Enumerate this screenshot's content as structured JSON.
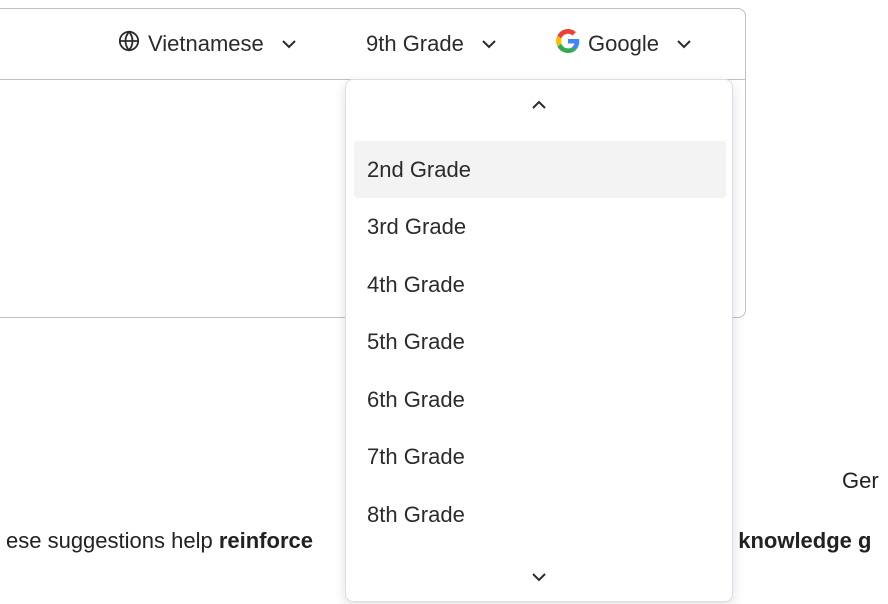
{
  "toolbar": {
    "language": {
      "label": "Vietnamese",
      "icon": "globe-icon"
    },
    "grade": {
      "label": "9th Grade"
    },
    "engine": {
      "label": "Google",
      "icon": "google-logo-icon"
    }
  },
  "dropdown": {
    "highlighted_index": 0,
    "options": [
      "2nd Grade",
      "3rd Grade",
      "4th Grade",
      "5th Grade",
      "6th Grade",
      "7th Grade",
      "8th Grade"
    ]
  },
  "background": {
    "text_right_top": "Ger",
    "text_left": "ese suggestions help ",
    "text_left_bold": "reinforce",
    "text_right_bold": "/ knowledge g"
  },
  "colors": {
    "border": "#b9c1cc",
    "highlight": "#f3f3f3",
    "text": "#2b2b2b",
    "google_blue": "#4285F4",
    "google_red": "#EA4335",
    "google_yellow": "#FBBC05",
    "google_green": "#34A853"
  }
}
